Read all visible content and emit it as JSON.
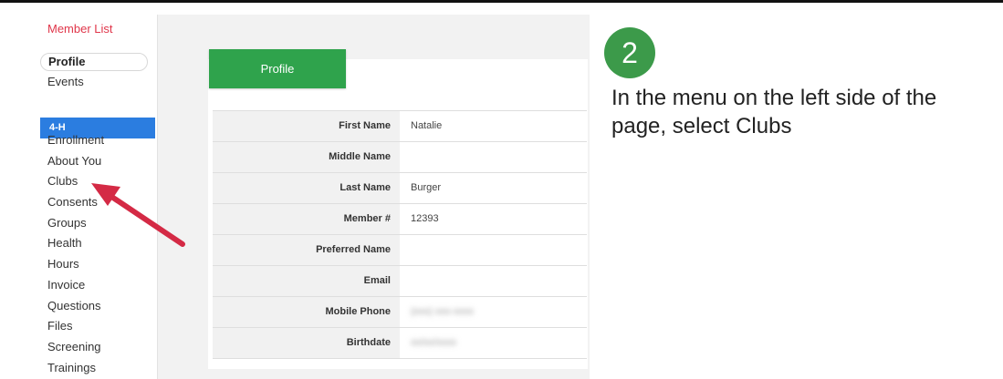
{
  "sidebar": {
    "member_list": "Member List",
    "profile": "Profile",
    "events": "Events",
    "section": "4-H",
    "items": [
      "Enrollment",
      "About You",
      "Clubs",
      "Consents",
      "Groups",
      "Health",
      "Hours",
      "Invoice",
      "Questions",
      "Files",
      "Screening",
      "Trainings"
    ]
  },
  "main": {
    "tab_label": "Profile",
    "fields": [
      {
        "label": "First Name",
        "value": "Natalie"
      },
      {
        "label": "Middle Name",
        "value": ""
      },
      {
        "label": "Last Name",
        "value": "Burger"
      },
      {
        "label": "Member #",
        "value": "12393"
      },
      {
        "label": "Preferred Name",
        "value": ""
      },
      {
        "label": "Email",
        "value": ""
      },
      {
        "label": "Mobile Phone",
        "value": "(xxx) xxx-xxxx"
      },
      {
        "label": "Birthdate",
        "value": "xx/xx/xxxx"
      }
    ]
  },
  "instruction": {
    "step": "2",
    "text": "In the menu on the left side of the page, select Clubs"
  },
  "colors": {
    "accent_blue": "#2b7de0",
    "accent_green": "#2fa34c",
    "arrow_red": "#d42a45"
  }
}
